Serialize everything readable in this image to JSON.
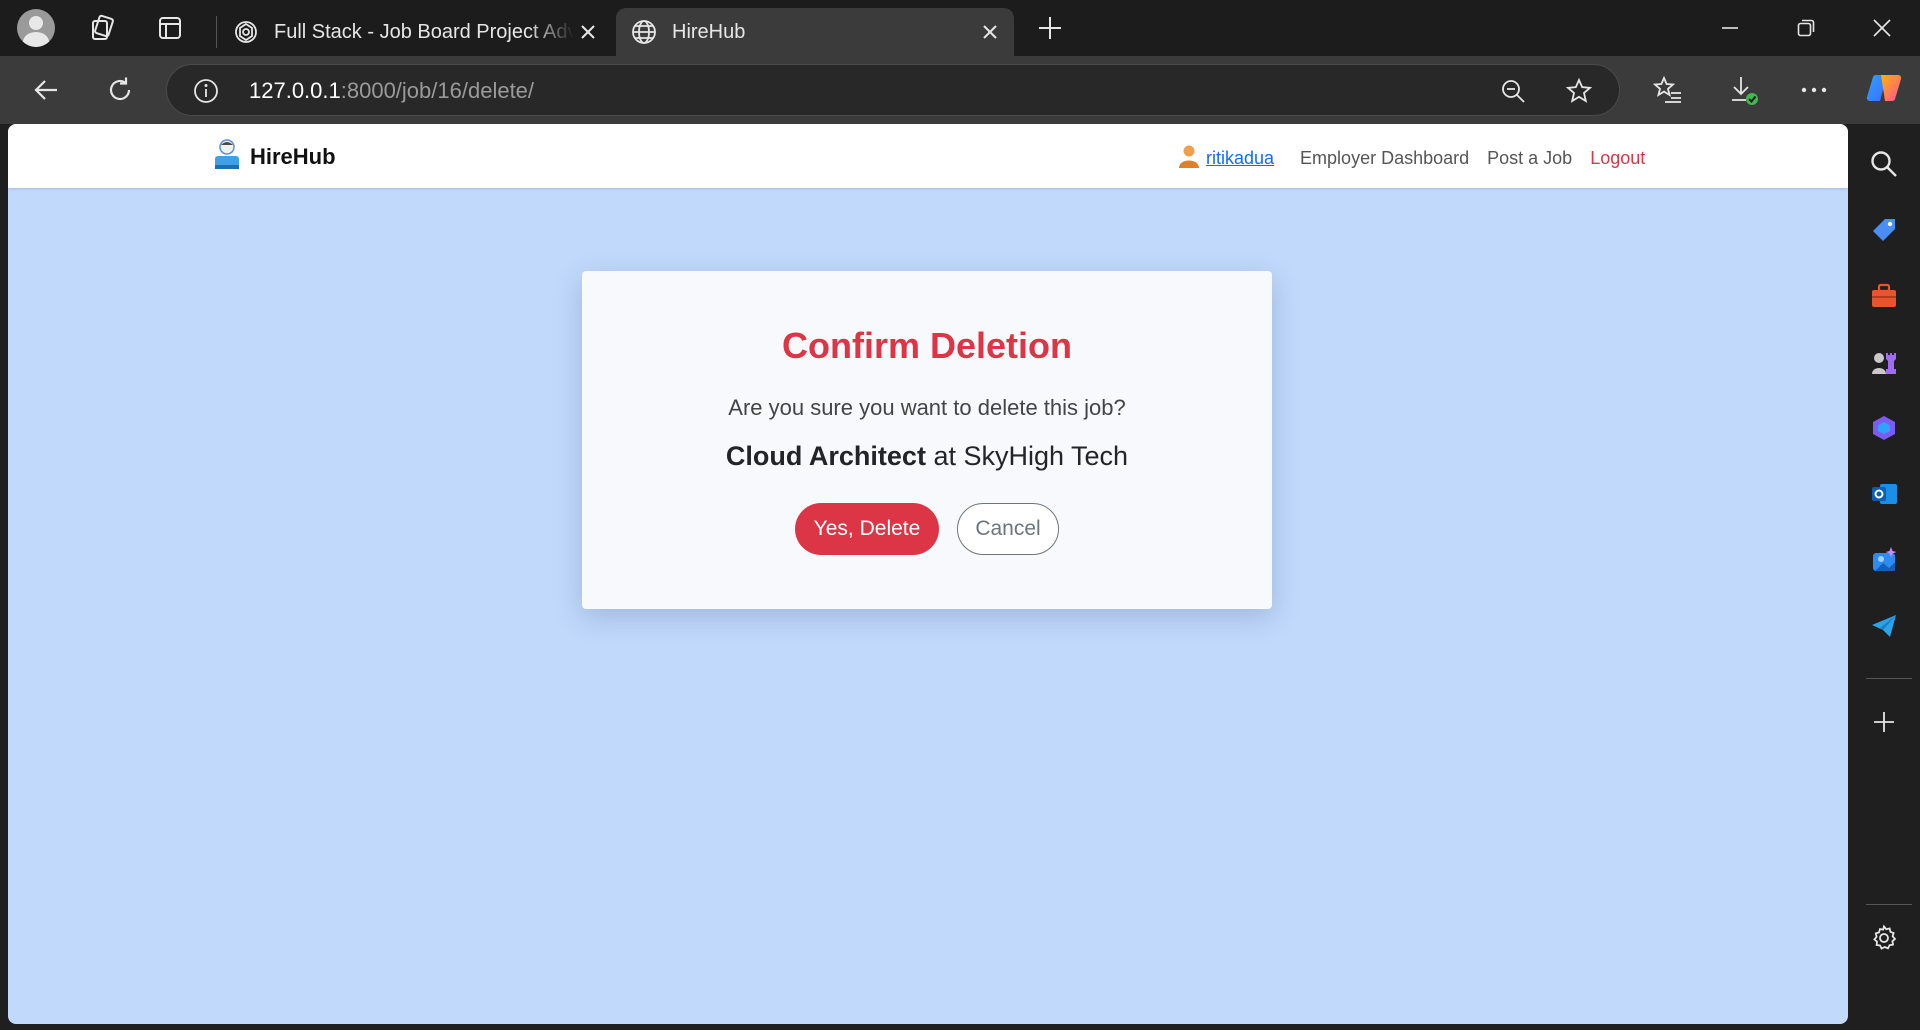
{
  "browser": {
    "tabs": [
      {
        "title": "Full Stack - Job Board Project Adv",
        "favicon": "openai-icon",
        "active": false
      },
      {
        "title": "HireHub",
        "favicon": "globe-icon",
        "active": true
      }
    ],
    "address": {
      "host": "127.0.0.1",
      "path": ":8000/job/16/delete/"
    }
  },
  "site": {
    "brand": "HireHub",
    "nav": {
      "username": "ritikadua",
      "employer_dashboard": "Employer Dashboard",
      "post_job": "Post a Job",
      "logout": "Logout"
    }
  },
  "dialog": {
    "title": "Confirm Deletion",
    "question": "Are you sure you want to delete this job?",
    "job_title": "Cloud Architect",
    "job_connector": " at ",
    "company": "SkyHigh Tech",
    "confirm_label": "Yes, Delete",
    "cancel_label": "Cancel"
  },
  "colors": {
    "danger": "#dc3545",
    "page_bg": "#c1d9fb",
    "link": "#0d6efd"
  }
}
